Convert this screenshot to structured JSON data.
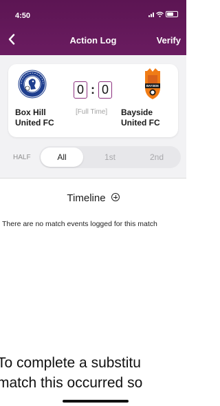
{
  "status_bar": {
    "time": "4:50"
  },
  "nav": {
    "back_icon": "chevron-left-icon",
    "title": "Action Log",
    "action": "Verify"
  },
  "colors": {
    "header": "#6a1c60",
    "score_border": "#8b2e7d"
  },
  "match": {
    "home": {
      "name_line1": "Box Hill",
      "name_line2": "United FC",
      "score": "0",
      "crest_icon": "box-hill-crest"
    },
    "away": {
      "name_line1": "Bayside",
      "name_line2": "United FC",
      "score": "0",
      "crest_icon": "bayside-crest"
    },
    "separator": ":",
    "status": "[Full Time]"
  },
  "half_filter": {
    "label": "HALF",
    "options": [
      {
        "label": "All",
        "selected": true
      },
      {
        "label": "1st",
        "selected": false
      },
      {
        "label": "2nd",
        "selected": false
      }
    ]
  },
  "timeline": {
    "title": "Timeline",
    "add_icon": "add-circle-icon",
    "empty_message": "There are no match events logged for this match"
  },
  "instruction": {
    "line1": "To complete a substitu",
    "line2": "match this occurred so"
  }
}
